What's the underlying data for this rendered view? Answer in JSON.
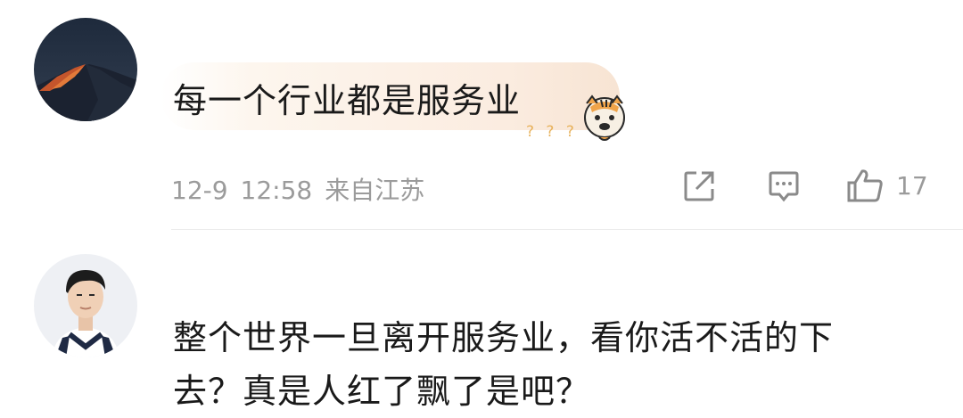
{
  "comments": [
    {
      "avatar_icon": "mountain-sunset-avatar",
      "text": "每一个行业都是服务业",
      "sticker_icon": "tiger-thinking-sticker",
      "sticker_marks": "? ? ?",
      "date": "12-9",
      "time": "12:58",
      "location": "来自江苏",
      "actions": {
        "share_icon": "share-icon",
        "comment_icon": "comment-icon",
        "like_icon": "thumbs-up-icon",
        "like_count": "17"
      }
    },
    {
      "avatar_icon": "young-man-avatar",
      "text_line1": "整个世界一旦离开服务业，看你活不活的下",
      "text_line2": "去？真是人红了飘了是吧？"
    }
  ],
  "colors": {
    "text": "#1a1a1a",
    "meta": "#9b9b9b",
    "bubble": "#fbece0",
    "divider": "#ececec"
  }
}
